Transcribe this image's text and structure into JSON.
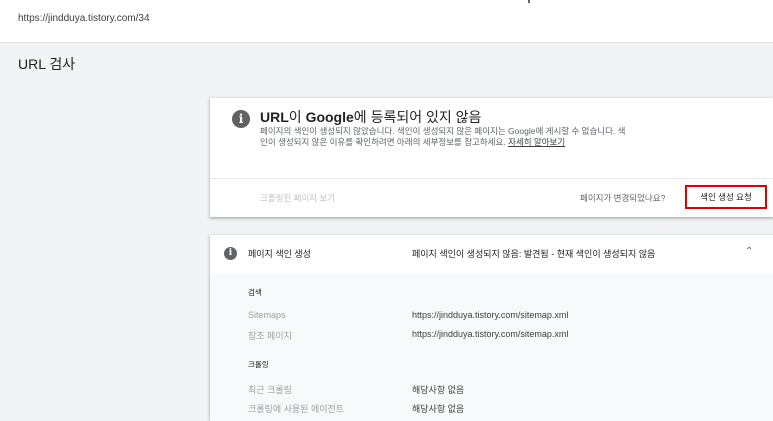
{
  "header": {
    "url": "https://jindduya.tistory.com/34"
  },
  "page_title": "URL 검사",
  "status_card": {
    "icon": "info-icon",
    "heading_url": "URL",
    "heading_mid": "이 ",
    "heading_google": "Google",
    "heading_rest": "에 등록되어 있지 않음",
    "description": "페이지의 색인이 생성되지 않았습니다. 색인이 생성되지 않은 페이지는 Google에 게시할 수 없습니다. 색인이 생성되지 않은 이유를 확인하려면 아래의 세부정보를 참고하세요.",
    "learn_more": "자세히 알아보기",
    "view_crawled": "크롤링된 페이지 보기",
    "page_changed_question": "페이지가 변경되었나요?",
    "request_indexing": "색인 생성 요청",
    "highlight_color": "#e00000"
  },
  "coverage": {
    "icon": "info-icon",
    "title": "페이지 색인 생성",
    "status": "페이지 색인이 생성되지 않음: 발견됨 - 현재 색인이 생성되지 않음",
    "toggle_icon": "chevron-up-icon",
    "sections": {
      "discovery": {
        "label": "검색",
        "sitemaps_label": "Sitemaps",
        "sitemaps_value": "https://jindduya.tistory.com/sitemap.xml",
        "referring_label": "참조 페이지",
        "referring_value": "https://jindduya.tistory.com/sitemap.xml"
      },
      "crawl": {
        "label": "크롤링",
        "last_crawl_label": "최근 크롤링",
        "last_crawl_value": "해당사항 없음",
        "crawled_as_label": "크롤링에 사용된 에이전트",
        "crawled_as_value": "해당사항 없음"
      }
    }
  }
}
